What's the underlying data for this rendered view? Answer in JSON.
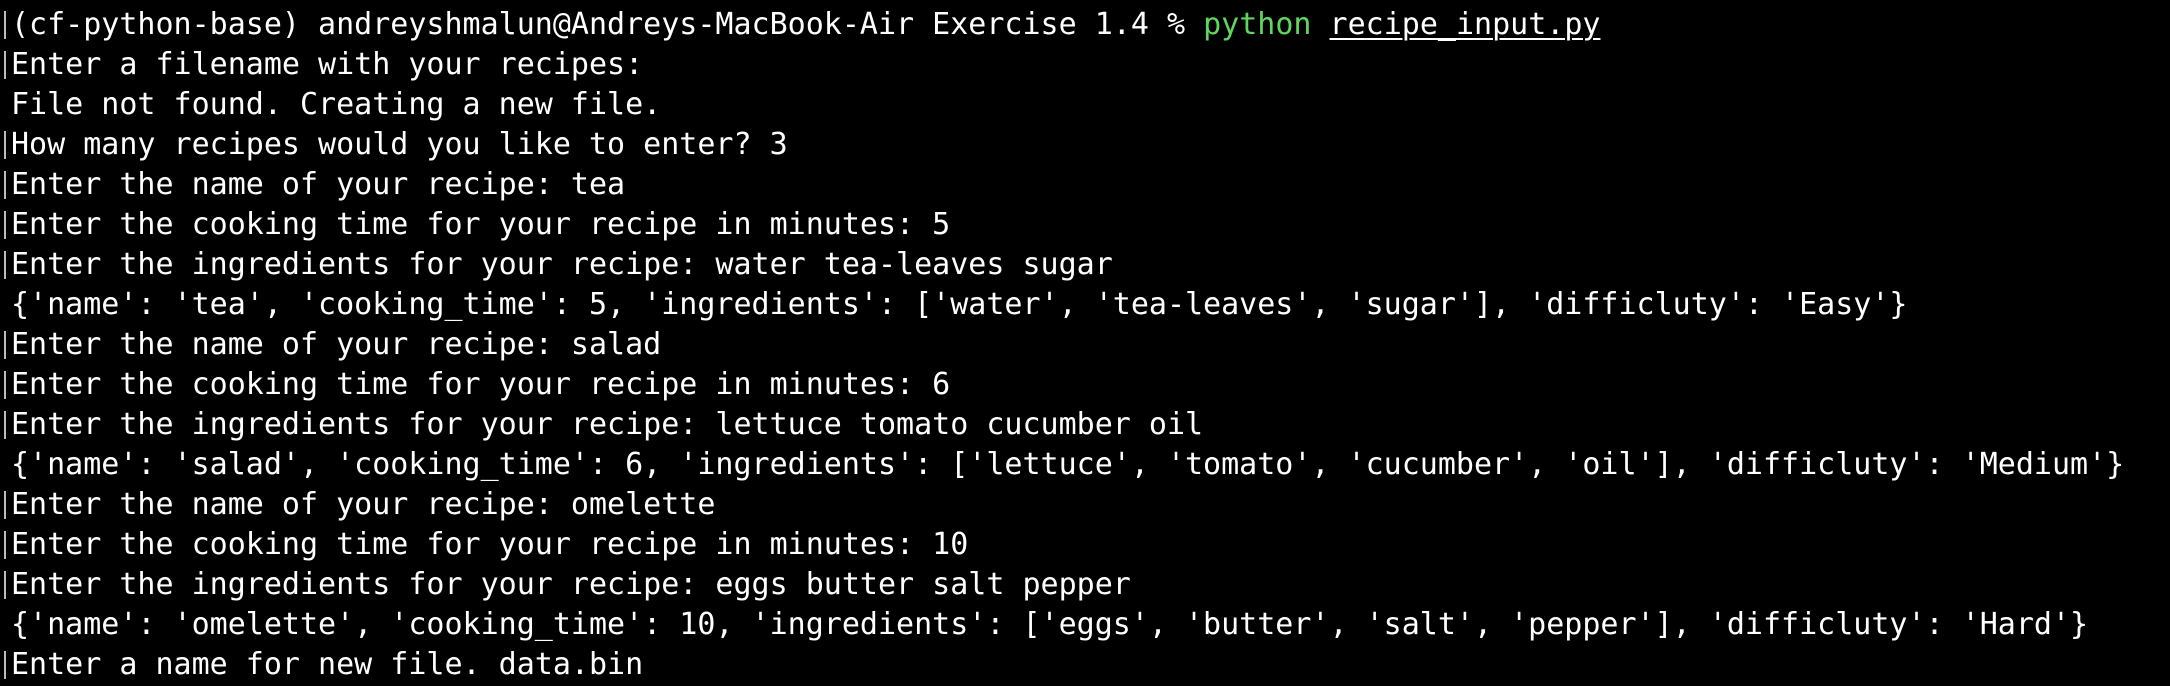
{
  "prompt": {
    "env": "(cf-python-base)",
    "user_host": "andreyshmalun@Andreys-MacBook-Air",
    "cwd": "Exercise 1.4",
    "symbol": "%",
    "command": "python",
    "argument": "recipe_input.py"
  },
  "lines": [
    "Enter a filename with your recipes:",
    "File not found. Creating a new file.",
    "How many recipes would you like to enter? 3",
    "Enter the name of your recipe: tea",
    "Enter the cooking time for your recipe in minutes: 5",
    "Enter the ingredients for your recipe: water tea-leaves sugar",
    "{'name': 'tea', 'cooking_time': 5, 'ingredients': ['water', 'tea-leaves', 'sugar'], 'difficluty': 'Easy'}",
    "Enter the name of your recipe: salad",
    "Enter the cooking time for your recipe in minutes: 6",
    "Enter the ingredients for your recipe: lettuce tomato cucumber oil",
    "{'name': 'salad', 'cooking_time': 6, 'ingredients': ['lettuce', 'tomato', 'cucumber', 'oil'], 'difficluty': 'Medium'}",
    "Enter the name of your recipe: omelette",
    "Enter the cooking time for your recipe in minutes: 10",
    "Enter the ingredients for your recipe: eggs butter salt pepper",
    "{'name': 'omelette', 'cooking_time': 10, 'ingredients': ['eggs', 'butter', 'salt', 'pepper'], 'difficluty': 'Hard'}",
    "Enter a name for new file. data.bin"
  ],
  "colors": {
    "background": "#000000",
    "text": "#ffffff",
    "command": "#5fd75f",
    "marker": "#bdbdbd"
  }
}
